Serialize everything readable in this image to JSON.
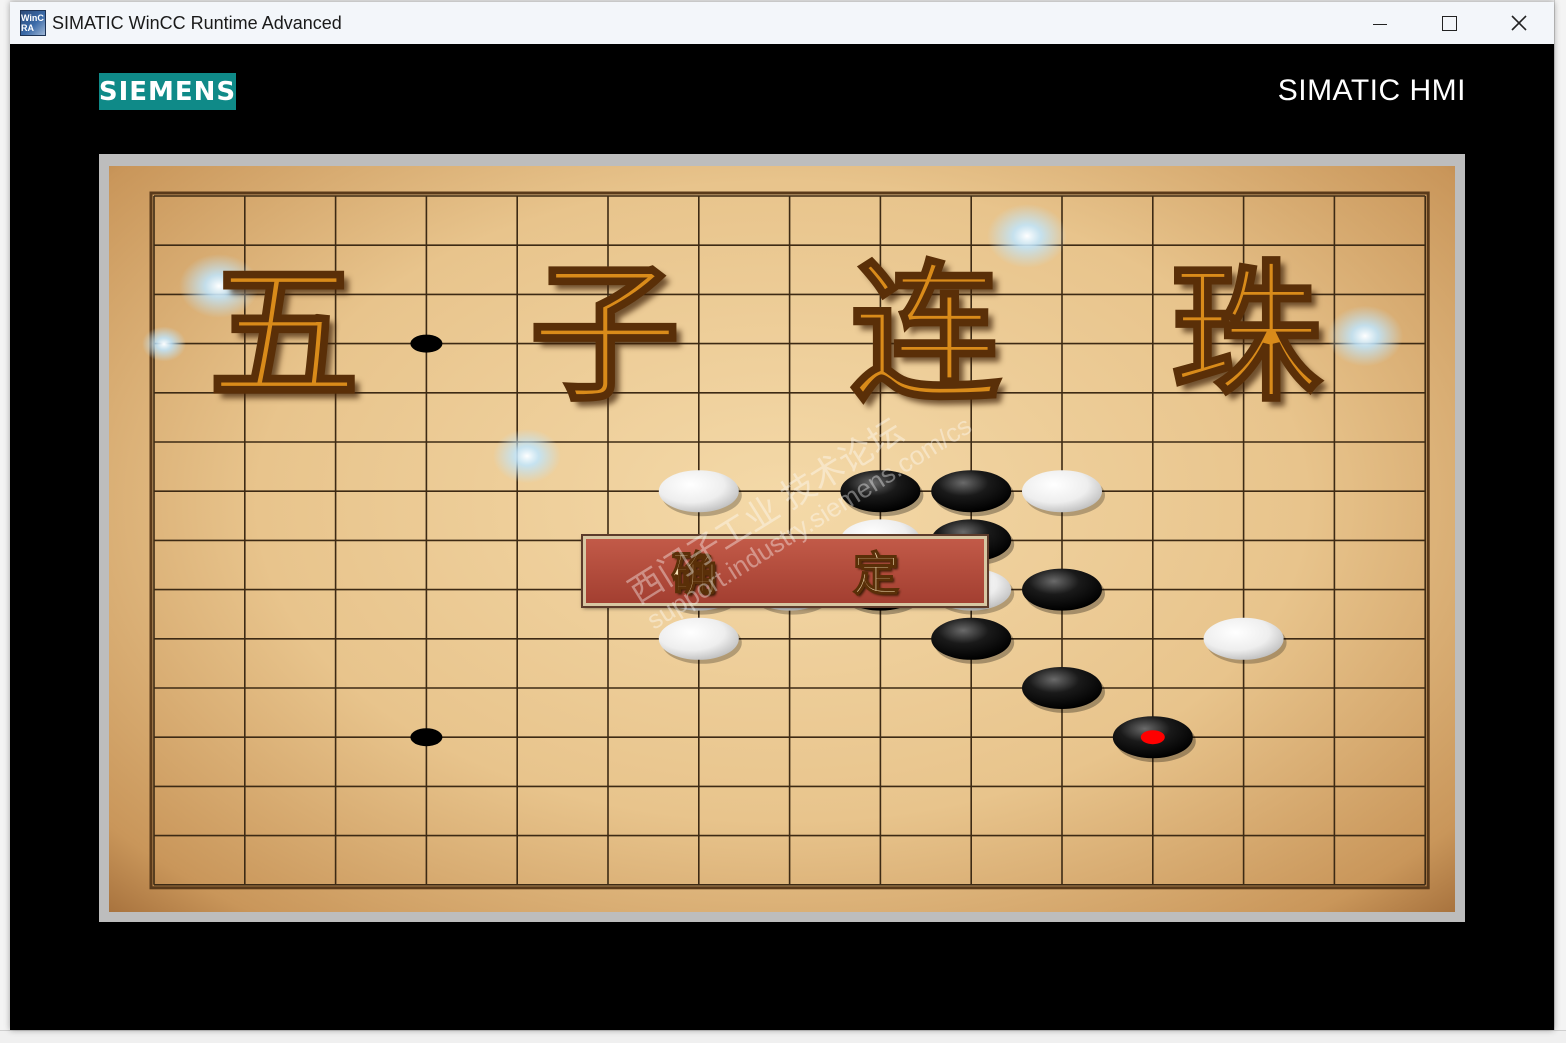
{
  "window": {
    "title": "SIMATIC WinCC Runtime Advanced",
    "icon": "wincc-ra-app-icon",
    "icon_text": "WinC RA",
    "controls": [
      "minimize-icon",
      "maximize-icon",
      "close-icon"
    ]
  },
  "header": {
    "logo_text": "SIEMENS",
    "logo_color": "#0f8a88",
    "brand": "SIMATIC HMI"
  },
  "game": {
    "title_chars": [
      "五",
      "子",
      "连",
      "珠"
    ],
    "confirm_label": "确 定",
    "grid": {
      "columns": 15,
      "rows": 15
    },
    "black_stones": [
      [
        8,
        6
      ],
      [
        9,
        6
      ],
      [
        9,
        7
      ],
      [
        8,
        8
      ],
      [
        10,
        8
      ],
      [
        9,
        9
      ],
      [
        10,
        10
      ],
      [
        11,
        11
      ]
    ],
    "white_stones": [
      [
        6,
        6
      ],
      [
        10,
        6
      ],
      [
        8,
        7
      ],
      [
        6,
        8
      ],
      [
        7,
        8
      ],
      [
        9,
        8
      ],
      [
        6,
        9
      ],
      [
        12,
        9
      ]
    ],
    "last_move": [
      11,
      11
    ],
    "last_move_marker_color": "#ff0000",
    "star_points": [
      [
        3,
        3
      ],
      [
        3,
        11
      ]
    ],
    "sparkle_color": "#bfe6ff"
  },
  "watermark": {
    "line1": "西门子工业  技术论坛",
    "line2": "support.industry.siemens.com/cs"
  }
}
